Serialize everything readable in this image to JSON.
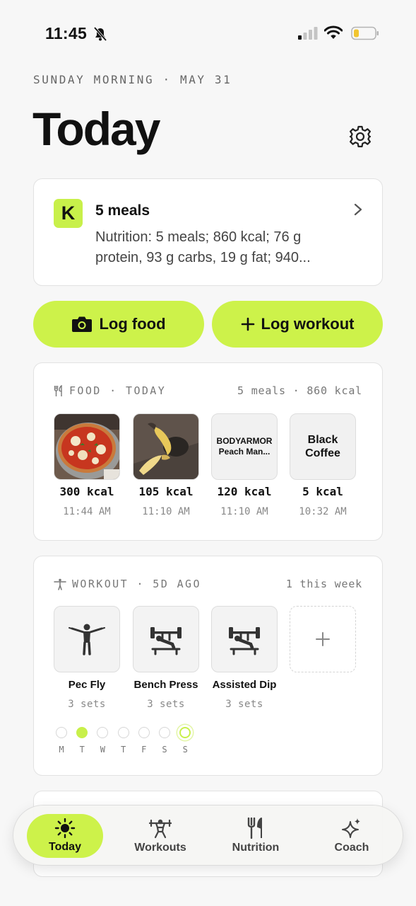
{
  "status_bar": {
    "time": "11:45"
  },
  "header": {
    "date_line": "SUNDAY MORNING · MAY 31",
    "title": "Today"
  },
  "summary": {
    "badge": "K",
    "title": "5 meals",
    "text": "Nutrition: 5 meals; 860 kcal; 76 g protein, 93 g carbs, 19 g fat; 940..."
  },
  "actions": {
    "log_food": "Log food",
    "log_workout": "Log workout"
  },
  "food": {
    "header": "FOOD · TODAY",
    "summary": "5 meals · 860 kcal",
    "items": [
      {
        "image": "pizza-photo",
        "label": "",
        "kcal": "300 kcal",
        "time": "11:44 AM"
      },
      {
        "image": "banana-photo",
        "label": "",
        "kcal": "105 kcal",
        "time": "11:10 AM"
      },
      {
        "image": "",
        "label": "BODYARMOR Peach Man...",
        "kcal": "120 kcal",
        "time": "11:10 AM"
      },
      {
        "image": "",
        "label": "Black Coffee",
        "kcal": "5 kcal",
        "time": "10:32 AM"
      }
    ]
  },
  "workout": {
    "header": "WORKOUT · 5D AGO",
    "summary": "1 this week",
    "exercises": [
      {
        "icon": "pec-fly-icon",
        "name": "Pec Fly",
        "sets": "3 sets"
      },
      {
        "icon": "bench-press-icon",
        "name": "Bench Press",
        "sets": "3 sets"
      },
      {
        "icon": "bench-press-icon",
        "name": "Assisted Dip",
        "sets": "3 sets"
      }
    ],
    "week_days": [
      "M",
      "T",
      "W",
      "T",
      "F",
      "S",
      "S"
    ],
    "completed_days": [
      1
    ],
    "current_day": 6
  },
  "tabs": [
    {
      "label": "Today",
      "icon": "sun-icon",
      "active": true
    },
    {
      "label": "Workouts",
      "icon": "weightlifter-icon",
      "active": false
    },
    {
      "label": "Nutrition",
      "icon": "fork-knife-icon",
      "active": false
    },
    {
      "label": "Coach",
      "icon": "sparkles-icon",
      "active": false
    }
  ],
  "colors": {
    "accent": "#cdf24a",
    "background": "#f7f7f7",
    "card": "#ffffff"
  }
}
